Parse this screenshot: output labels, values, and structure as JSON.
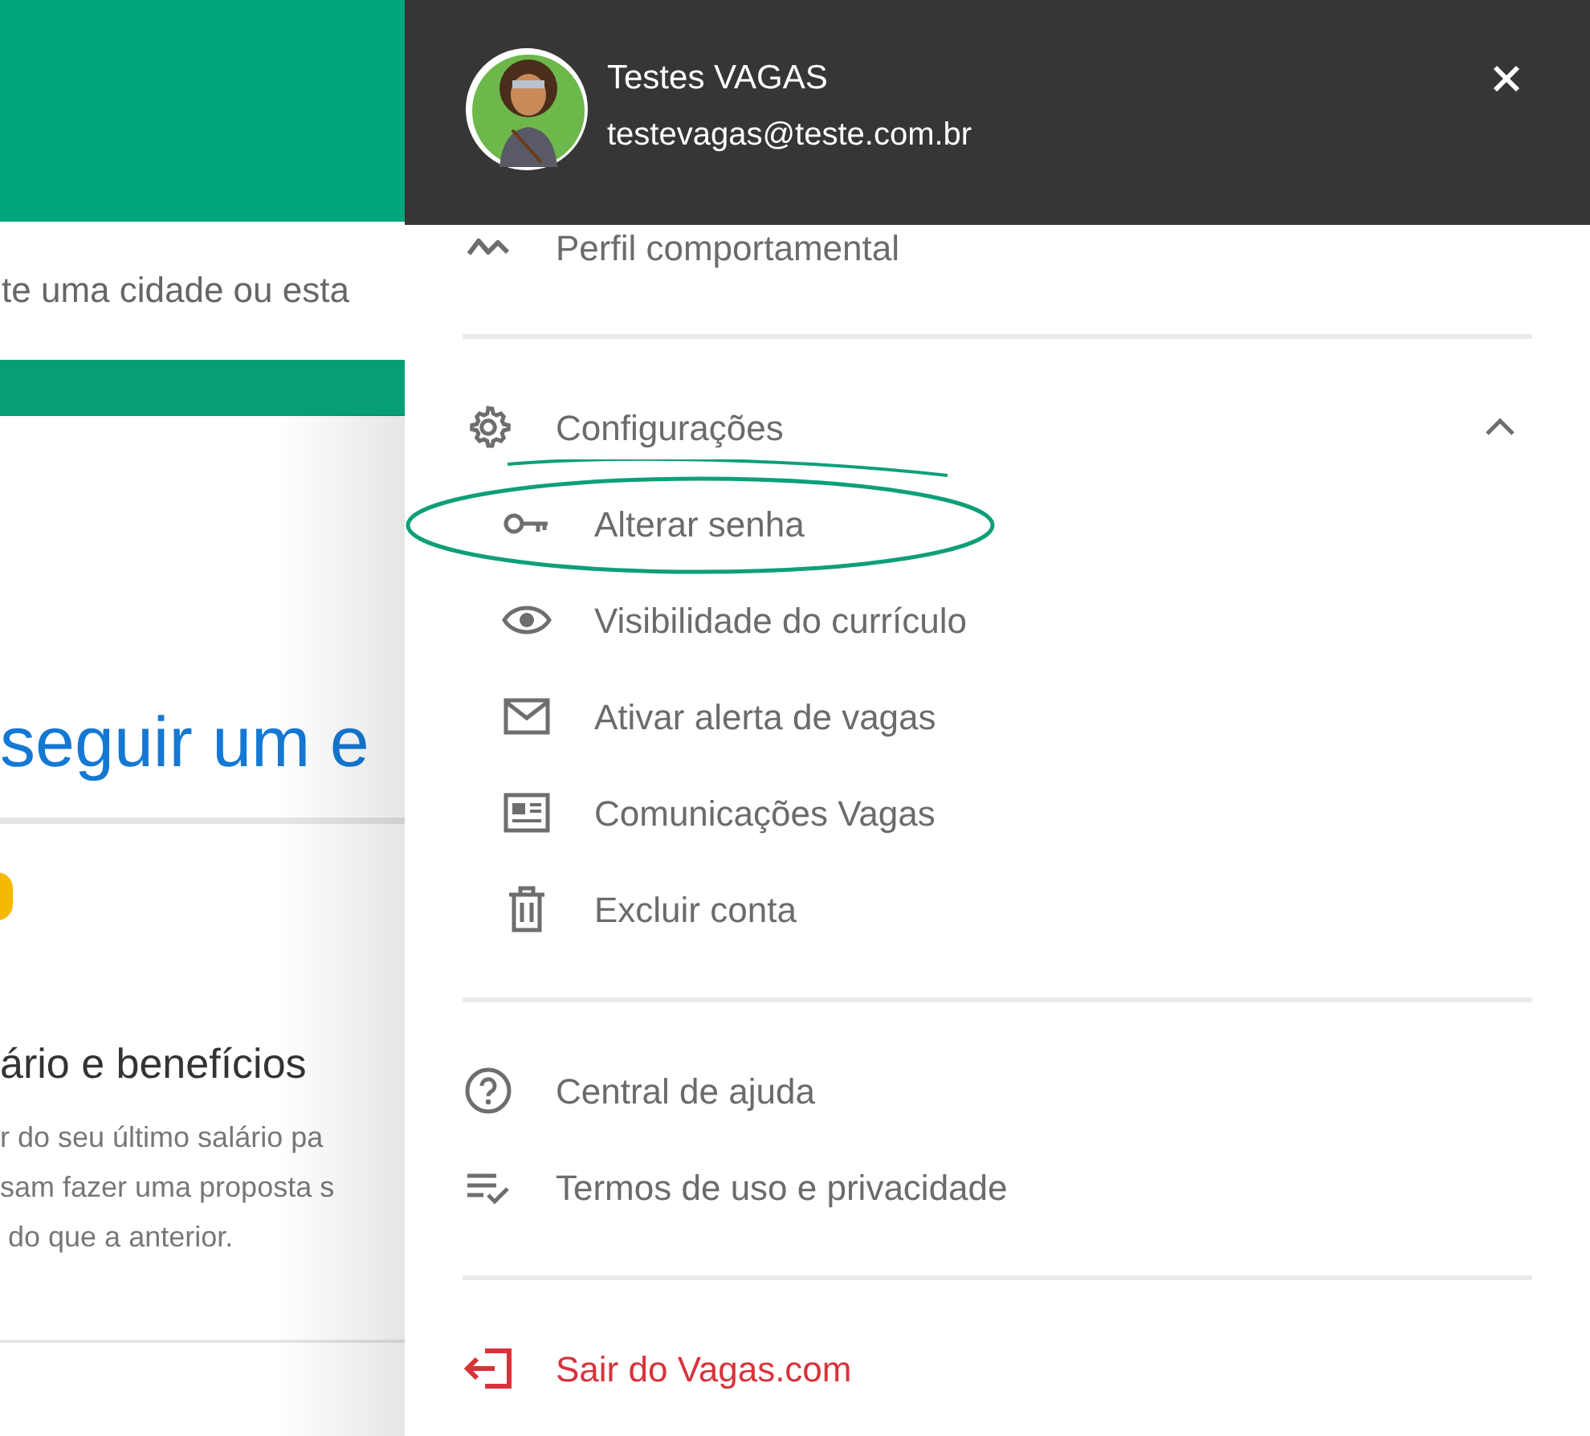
{
  "background_page": {
    "search_field": {
      "placeholder": "te uma cidade ou esta"
    },
    "heading": "seguir um e",
    "card": {
      "title": "ário e benefícios",
      "lines": [
        "r do seu último salário pa",
        "sam fazer uma proposta s",
        "do que a anterior."
      ]
    }
  },
  "drawer": {
    "user": {
      "name": "Testes VAGAS",
      "email": "testevagas@teste.com.br"
    },
    "sections": [
      [
        {
          "label": "Perfil comportamental",
          "kind": "link"
        }
      ],
      [
        {
          "label": "Configurações",
          "kind": "group",
          "expanded": true,
          "children": [
            {
              "label": "Alterar senha"
            },
            {
              "label": "Visibilidade do currículo"
            },
            {
              "label": "Ativar alerta de vagas"
            },
            {
              "label": "Comunicações Vagas"
            },
            {
              "label": "Excluir conta"
            }
          ]
        }
      ],
      [
        {
          "label": "Central de ajuda",
          "kind": "link"
        },
        {
          "label": "Termos de uso e privacidade",
          "kind": "link"
        }
      ],
      [
        {
          "label": "Sair do Vagas.com",
          "kind": "danger"
        }
      ]
    ]
  }
}
